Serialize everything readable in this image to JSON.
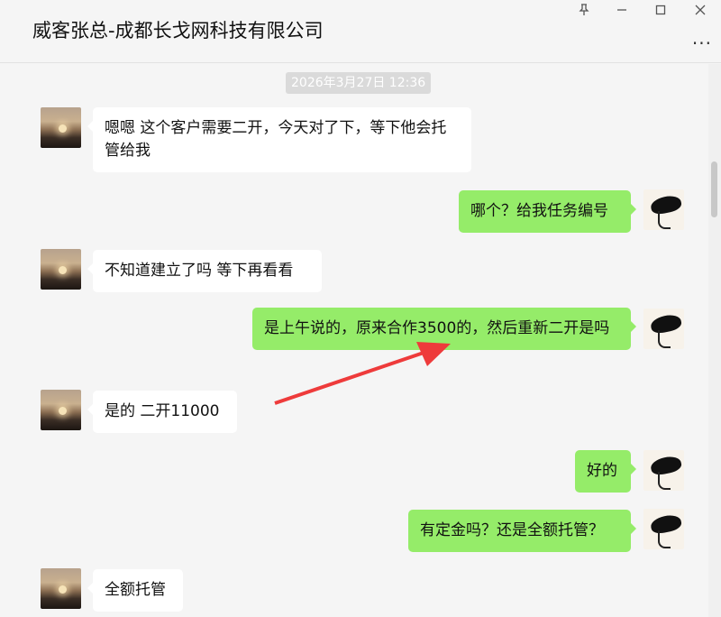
{
  "window": {
    "title": "威客张总-成都长戈网科技有限公司",
    "pin_icon": "pin-icon",
    "minimize_icon": "minimize-icon",
    "maximize_icon": "maximize-icon",
    "close_icon": "close-icon",
    "more_label": "..."
  },
  "chat": {
    "timestamp": "2026年3月27日 12:36",
    "messages": [
      {
        "side": "in",
        "text": "嗯嗯 这个客户需要二开，今天对了下，等下他会托管给我"
      },
      {
        "side": "out",
        "text": "哪个？给我任务编号"
      },
      {
        "side": "in",
        "text": "不知道建立了吗 等下再看看"
      },
      {
        "side": "out",
        "text": "是上午说的，原来合作3500的，然后重新二开是吗"
      },
      {
        "side": "in",
        "text": "是的 二开11000"
      },
      {
        "side": "out",
        "text": "好的"
      },
      {
        "side": "out",
        "text": "有定金吗？还是全额托管？"
      },
      {
        "side": "in",
        "text": "全额托管"
      }
    ]
  },
  "colors": {
    "incoming_bubble": "#ffffff",
    "outgoing_bubble": "#95ec69",
    "annotation_arrow": "#ee3b3b"
  }
}
